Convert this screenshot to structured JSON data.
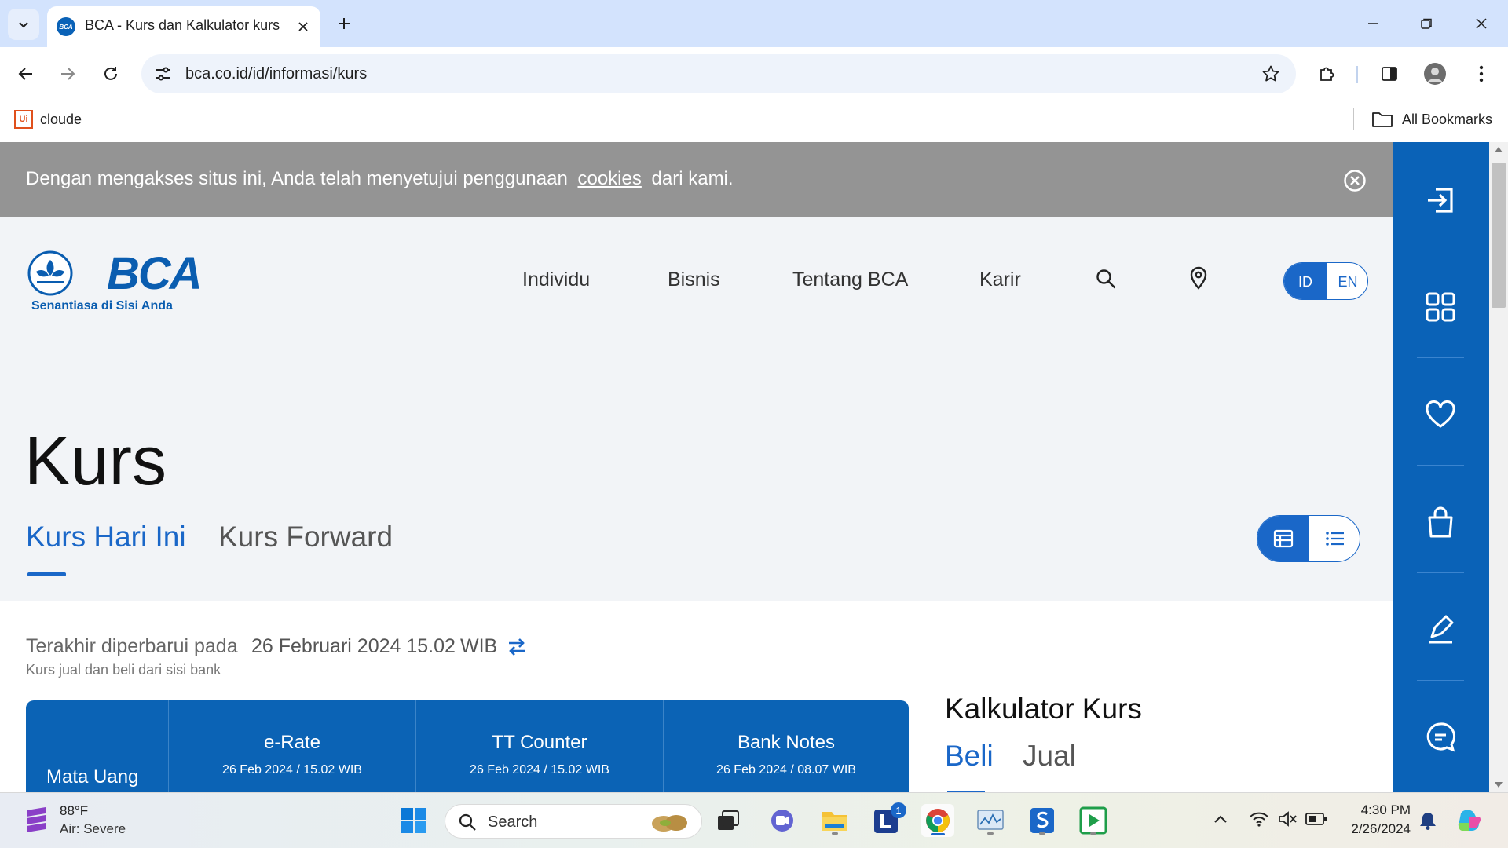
{
  "browser": {
    "tab_title": "BCA - Kurs dan Kalkulator kurs",
    "favicon_text": "BCA",
    "url": "bca.co.id/id/informasi/kurs",
    "bookmarks": {
      "item_icon_text": "Ui",
      "item_label": "cloude",
      "all_bookmarks": "All Bookmarks"
    }
  },
  "cookie": {
    "text_before": "Dengan mengakses situs ini, Anda telah menyetujui penggunaan",
    "link": "cookies",
    "text_after": "dari kami."
  },
  "header": {
    "logo_text": "BCA",
    "logo_tagline": "Senantiasa di Sisi Anda",
    "nav": [
      "Individu",
      "Bisnis",
      "Tentang BCA",
      "Karir"
    ],
    "lang_id": "ID",
    "lang_en": "EN"
  },
  "main": {
    "title": "Kurs",
    "tabs": [
      "Kurs Hari Ini",
      "Kurs Forward"
    ],
    "updated_label": "Terakhir diperbarui pada",
    "updated_date": "26 Februari 2024 15.02",
    "updated_tz": "WIB",
    "updated_sub": "Kurs jual dan beli dari sisi bank",
    "table": {
      "currency_header": "Mata Uang",
      "columns": [
        {
          "label": "e-Rate",
          "sub": "26 Feb 2024 / 15.02 WIB"
        },
        {
          "label": "TT Counter",
          "sub": "26 Feb 2024 / 15.02 WIB"
        },
        {
          "label": "Bank Notes",
          "sub": "26 Feb 2024 / 08.07 WIB"
        }
      ]
    },
    "calculator": {
      "title": "Kalkulator Kurs",
      "tab_buy": "Beli",
      "tab_sell": "Jual"
    }
  },
  "taskbar": {
    "weather_temp": "88°F",
    "weather_desc": "Air: Severe",
    "search_placeholder": "Search",
    "badge_count": "1",
    "time": "4:30 PM",
    "date": "2/26/2024"
  },
  "colors": {
    "brand_blue": "#0a62b7",
    "accent_blue": "#1a67c8",
    "cookie_gray": "#949494"
  }
}
